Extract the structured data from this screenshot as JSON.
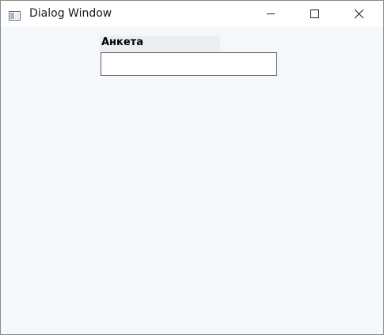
{
  "window": {
    "title": "Dialog Window",
    "icon": "dialog-app-icon",
    "controls": {
      "minimize_icon": "minimize-icon",
      "maximize_icon": "maximize-icon",
      "close_icon": "close-icon"
    }
  },
  "form": {
    "label": "Анкета",
    "input_value": "",
    "input_placeholder": ""
  },
  "colors": {
    "client_background": "#f4f7fb",
    "titlebar_background": "#ffffff",
    "input_border": "#5a5a5a"
  }
}
